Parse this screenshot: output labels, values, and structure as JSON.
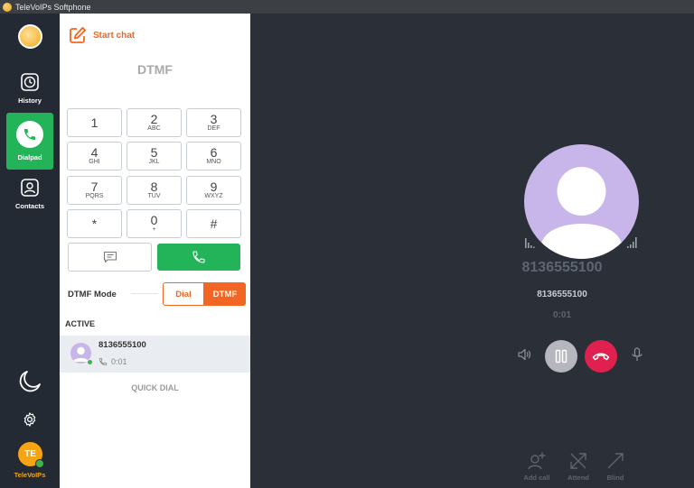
{
  "window": {
    "title": "TeleVoIPs Softphone"
  },
  "sidebar": {
    "items": [
      {
        "label": "History",
        "icon": "clock-icon"
      },
      {
        "label": "Dialpad",
        "icon": "phone-icon"
      },
      {
        "label": "Contacts",
        "icon": "contact-icon"
      }
    ],
    "user": {
      "initials": "TE",
      "name": "TeleVoIPs"
    }
  },
  "panel": {
    "start_chat": "Start chat",
    "title": "DTMF",
    "keys": [
      {
        "num": "1",
        "sub": ""
      },
      {
        "num": "2",
        "sub": "ABC"
      },
      {
        "num": "3",
        "sub": "DEF"
      },
      {
        "num": "4",
        "sub": "GHI"
      },
      {
        "num": "5",
        "sub": "JKL"
      },
      {
        "num": "6",
        "sub": "MNO"
      },
      {
        "num": "7",
        "sub": "PQRS"
      },
      {
        "num": "8",
        "sub": "TUV"
      },
      {
        "num": "9",
        "sub": "WXYZ"
      },
      {
        "num": "*",
        "sub": ""
      },
      {
        "num": "0",
        "sub": "+"
      },
      {
        "num": "#",
        "sub": ""
      }
    ],
    "dtmf_mode_label": "DTMF Mode",
    "mode_options": {
      "dial": "Dial",
      "dtmf": "DTMF"
    },
    "active_label": "ACTIVE",
    "active_call": {
      "number": "8136555100",
      "duration": "0:01"
    },
    "quick_dial": "QUICK DIAL"
  },
  "call": {
    "number_large": "8136555100",
    "number_small": "8136555100",
    "timer": "0:01",
    "actions": [
      {
        "label": "Add call",
        "icon": "add-user-icon"
      },
      {
        "label": "Attend",
        "icon": "attended-transfer-icon"
      },
      {
        "label": "Blind",
        "icon": "blind-transfer-icon"
      }
    ]
  },
  "colors": {
    "accent": "#f26522",
    "green": "#23b45a",
    "hangup": "#e0214f",
    "avatar": "#c8b5ea",
    "sidebar": "#242a34",
    "main_bg": "#2b3038"
  }
}
